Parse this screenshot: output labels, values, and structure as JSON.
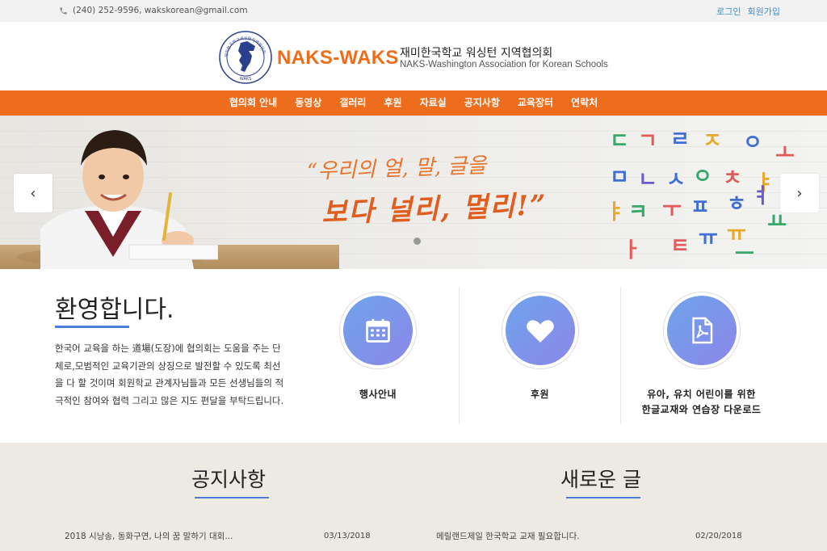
{
  "topbar": {
    "contact": "(240) 252-9596, wakskorean@gmail.com",
    "login": "로그인",
    "signup": "회원가입"
  },
  "header": {
    "brand": "NAKS-WAKS",
    "org_ko": "재미한국학교 워싱턴 지역협의회",
    "org_en": "NAKS-Washington Association for Korean Schools",
    "seal_text": "재미한국학교워싱턴지역협의회",
    "seal_bottom": "WAKS"
  },
  "nav": {
    "items": [
      "협의회 안내",
      "동영상",
      "갤러리",
      "후원",
      "자료실",
      "공지사항",
      "교육장터",
      "연락처"
    ]
  },
  "hero": {
    "slogan_line1": "“우리의 얼, 말, 글을",
    "slogan_line2": "보다 널리, 멀리!”",
    "prev": "‹",
    "next": "›"
  },
  "welcome": {
    "title": "환영합니다.",
    "text": "한국어 교육을 하는 道場(도장)에 협의회는 도움을 주는 단체로,모범적인 교육기관의 상징으로 발전할 수 있도록 최선을 다 할 것이며 회원학교 관계자님들과 모든 선생님들의 적극적인 참여와 협력 그리고 많은 지도 편달을 부탁드립니다."
  },
  "features": [
    {
      "icon": "calendar-icon",
      "label": "행사안내"
    },
    {
      "icon": "heart-icon",
      "label": "후원"
    },
    {
      "icon": "pdf-icon",
      "label_line1": "유아, 유치 어린이를 위한",
      "label_line2": "한글교재와 연습장 다운로드"
    }
  ],
  "notices": {
    "title": "공지사항",
    "items": [
      {
        "title": "2018 시낭송, 동화구연, 나의 꿈 말하기 대회...",
        "date": "03/13/2018"
      }
    ]
  },
  "new_posts": {
    "title": "새로운 글",
    "items": [
      {
        "title": "메릴랜드제일 한국학교 교재 필요합니다.",
        "date": "02/20/2018"
      }
    ]
  },
  "colors": {
    "brand_orange": "#ee6d1c",
    "accent_blue": "#4a7fd8",
    "link_blue": "#3b8fd9"
  }
}
